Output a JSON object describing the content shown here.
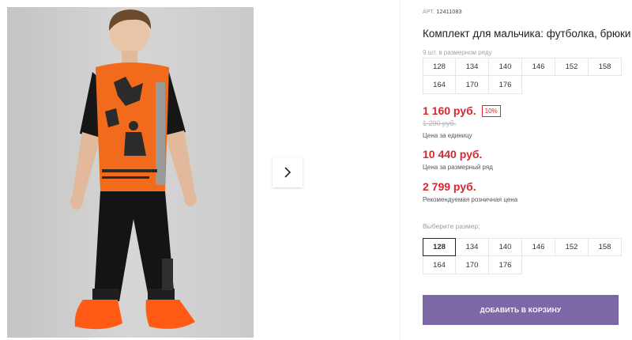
{
  "product": {
    "art_label": "АРТ.",
    "art_code": "12411083",
    "title": "Комплект для мальчика: футболка, брюки",
    "sizes_note": "9 шт. в размерном ряду",
    "size_row": [
      "128",
      "134",
      "140",
      "146",
      "152",
      "158",
      "164",
      "170",
      "176"
    ]
  },
  "prices": {
    "current": "1 160 руб.",
    "discount": "10%",
    "old": "1 290 руб.",
    "unit_label": "Цена за единицу",
    "row_price": "10 440 руб.",
    "row_label": "Цена за размерный ряд",
    "retail_price": "2 799 руб.",
    "retail_label": "Рекомендуемая розничная цена"
  },
  "size_picker": {
    "label": "Выберите размер:",
    "options": [
      "128",
      "134",
      "140",
      "146",
      "152",
      "158",
      "164",
      "170",
      "176"
    ],
    "selected": "128"
  },
  "cart_button": {
    "label": "ДОБАВИТЬ В КОРЗИНУ"
  },
  "gallery": {
    "next_icon": "chevron-right-icon"
  },
  "colors": {
    "accent": "#7c68a6",
    "price_red": "#d9272e",
    "shirt_orange": "#f26a1b"
  }
}
